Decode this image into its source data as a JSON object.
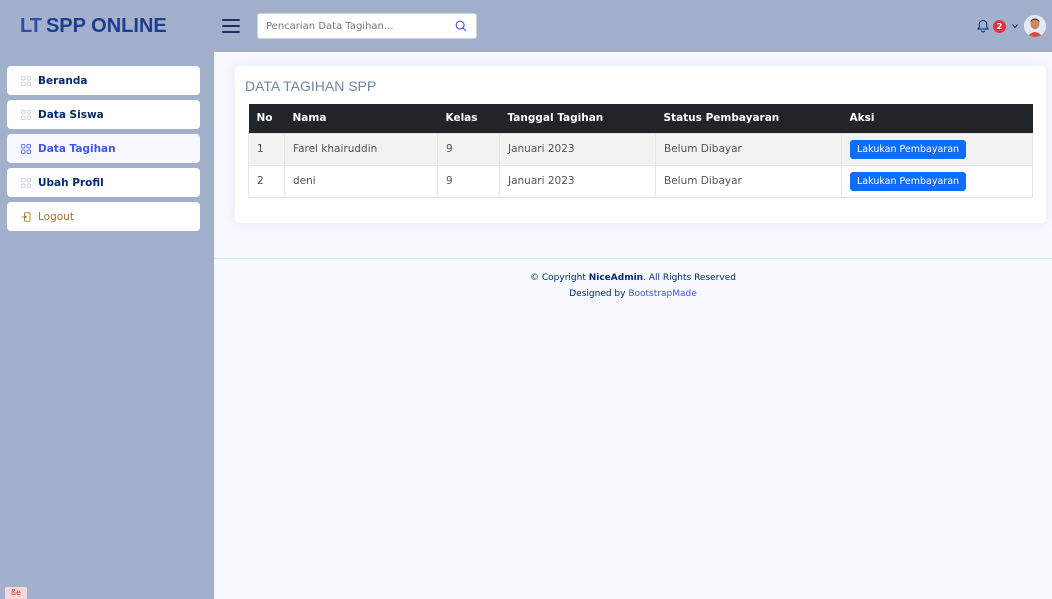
{
  "header": {
    "logo_mark": "LT",
    "app_title": "SPP ONLINE",
    "search_placeholder": "Pencarian Data Tagihan...",
    "notification_count": "2"
  },
  "sidebar": {
    "items": [
      {
        "label": "Beranda",
        "icon": "grid-icon"
      },
      {
        "label": "Data Siswa",
        "icon": "grid-icon"
      },
      {
        "label": "Data Tagihan",
        "icon": "grid-icon",
        "active": true
      },
      {
        "label": "Ubah Profil",
        "icon": "grid-icon"
      },
      {
        "label": "Logout",
        "icon": "logout-icon"
      }
    ],
    "corner_mark": "ße"
  },
  "main": {
    "title": "DATA TAGIHAN SPP",
    "columns": [
      "No",
      "Nama",
      "Kelas",
      "Tanggal Tagihan",
      "Status Pembayaran",
      "Aksi"
    ],
    "rows": [
      {
        "no": "1",
        "nama": "Farel khairuddin",
        "kelas": "9",
        "tanggal": "Januari 2023",
        "status": "Belum Dibayar",
        "aksi": "Lakukan Pembayaran"
      },
      {
        "no": "2",
        "nama": "deni",
        "kelas": "9",
        "tanggal": "Januari 2023",
        "status": "Belum Dibayar",
        "aksi": "Lakukan Pembayaran"
      }
    ]
  },
  "footer": {
    "copyright_prefix": "© Copyright ",
    "brand": "NiceAdmin",
    "copyright_suffix": ". All Rights Reserved",
    "designed_prefix": "Designed by ",
    "designed_link": "BootstrapMade"
  },
  "colors": {
    "header_bg": "#a3b0cc",
    "primary": "#0d6efd",
    "active_nav": "#4154f1",
    "table_head": "#212529",
    "badge": "#dc3545"
  }
}
